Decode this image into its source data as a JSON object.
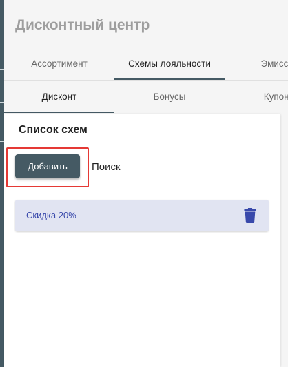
{
  "app": {
    "title": "Дисконтный центр"
  },
  "top_tabs": [
    {
      "label": "Ассортимент",
      "active": false
    },
    {
      "label": "Схемы лояльности",
      "active": true
    },
    {
      "label": "Эмиссии",
      "active": false
    }
  ],
  "sub_tabs": [
    {
      "label": "Дисконт",
      "active": true
    },
    {
      "label": "Бонусы",
      "active": false
    },
    {
      "label": "Купоны",
      "active": false
    }
  ],
  "panel": {
    "title": "Список схем",
    "add_label": "Добавить",
    "search_placeholder": "Поиск",
    "items": [
      {
        "label": "Скидка 20%"
      }
    ]
  },
  "colors": {
    "primary": "#455a64",
    "item_bg": "#e1e4f2",
    "item_text": "#3949ab",
    "highlight": "#e53935"
  },
  "icons": {
    "delete": "trash-icon"
  }
}
